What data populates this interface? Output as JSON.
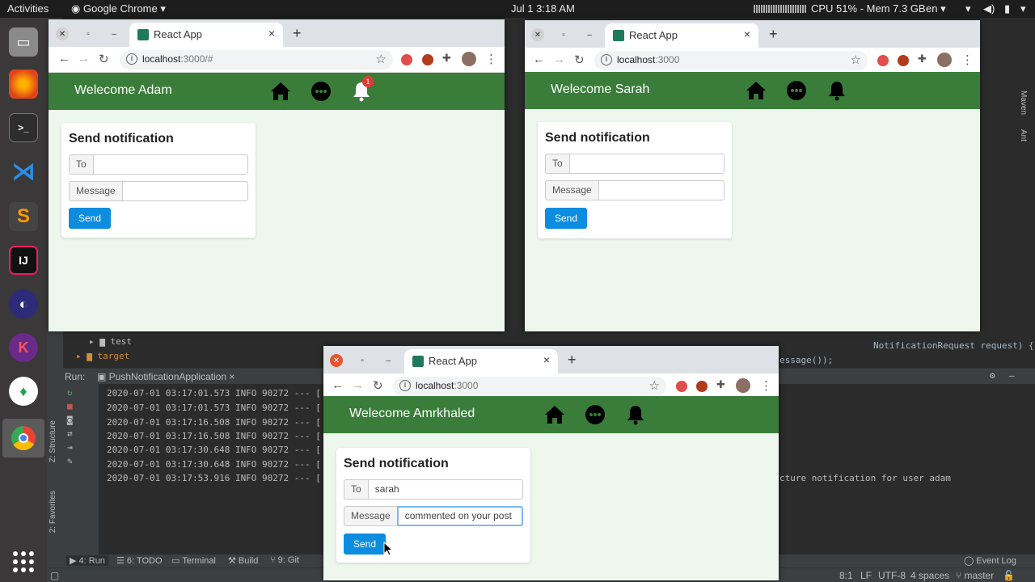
{
  "topbar": {
    "activities": "Activities",
    "app_name": "Google Chrome",
    "datetime": "Jul 1  3:18 AM",
    "sysinfo": "CPU 51% - Mem 7.3 GB",
    "lang": "en"
  },
  "ide": {
    "tree_test": "test",
    "tree_target": "target",
    "run_label": "Run:",
    "run_config": "PushNotificationApplication",
    "log_lines": [
      "2020-07-01 03:17:01.573  INFO 90272 --- [",
      "2020-07-01 03:17:01.573  INFO 90272 --- [",
      "2020-07-01 03:17:16.508  INFO 90272 --- [",
      "2020-07-01 03:17:16.508  INFO 90272 --- [",
      "2020-07-01 03:17:30.648  INFO 90272 --- [",
      "2020-07-01 03:17:30.648  INFO 90272 --- [",
      "2020-07-01 03:17:53.916  INFO 90272 --- ["
    ],
    "code_request": "NotificationRequest request) {",
    "code_message": "essage());",
    "log_tail": "cture notification for user adam",
    "tools": {
      "run": "4: Run",
      "todo": "6: TODO",
      "terminal": "Terminal",
      "build": "Build",
      "git": "9: Git",
      "event_log": "Event Log"
    },
    "side": {
      "structure": "Z: Structure",
      "favorites": "2: Favorites",
      "maven": "Maven",
      "ant": "Ant"
    },
    "status": {
      "pos": "8:1",
      "lf": "LF",
      "enc": "UTF-8",
      "indent": "4 spaces",
      "branch": "master"
    }
  },
  "windows": [
    {
      "tab_title": "React App",
      "url_host": "localhost",
      "url_rest": ":3000/#",
      "welcome": "Welecome Adam",
      "badge": "1",
      "card_title": "Send notification",
      "to_label": "To",
      "to_value": "",
      "msg_label": "Message",
      "msg_value": "",
      "send_label": "Send"
    },
    {
      "tab_title": "React App",
      "url_host": "localhost",
      "url_rest": ":3000",
      "welcome": "Welecome Sarah",
      "card_title": "Send notification",
      "to_label": "To",
      "to_value": "",
      "msg_label": "Message",
      "msg_value": "",
      "send_label": "Send"
    },
    {
      "tab_title": "React App",
      "url_host": "localhost",
      "url_rest": ":3000",
      "welcome": "Welecome Amrkhaled",
      "card_title": "Send notification",
      "to_label": "To",
      "to_value": "sarah",
      "msg_label": "Message",
      "msg_value": "commented on your post",
      "send_label": "Send"
    }
  ],
  "colors": {
    "header_green": "#3a7d3a",
    "send_blue": "#0d8de0",
    "page_bg": "#eef7ee"
  }
}
